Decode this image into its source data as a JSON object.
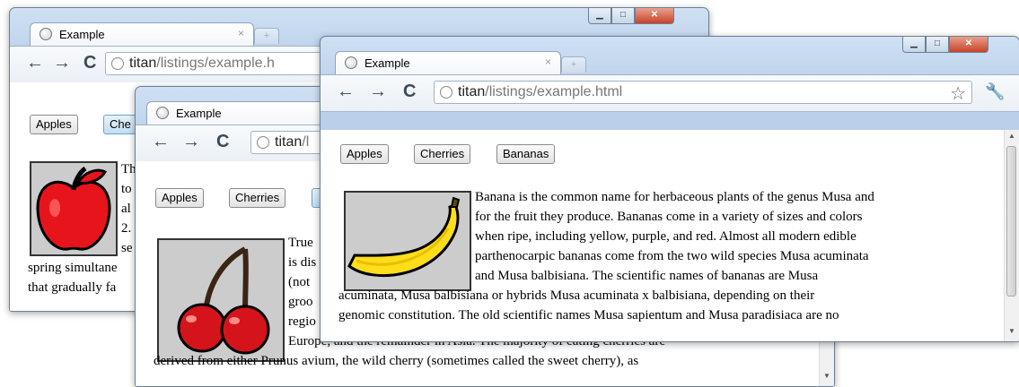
{
  "windows": {
    "apples": {
      "tab_title": "Example",
      "url_host": "titan",
      "url_path": "/listings/example.h",
      "buttons": [
        "Apples",
        "Che"
      ],
      "text_lines": [
        "Th",
        "to",
        "al",
        "2.",
        "se",
        "spring simultane",
        "that gradually fa"
      ]
    },
    "cherries": {
      "tab_title": "Example",
      "url_host": "titan",
      "url_path": "/l",
      "buttons": [
        "Apples",
        "Cherries",
        ""
      ],
      "text_lines": [
        "True",
        "is dis",
        "(not",
        "groo",
        "regio",
        "Europe, and the remainder in Asia. The majority of eating cherries are",
        "derived from either Prunus avium, the wild cherry (sometimes called the sweet cherry), as"
      ]
    },
    "bananas": {
      "tab_title": "Example",
      "url_host": "titan",
      "url_path": "/listings/example.html",
      "buttons": [
        "Apples",
        "Cherries",
        "Bananas"
      ],
      "text_lines": [
        "Banana is the common name for herbaceous plants of the genus Musa and",
        "for the fruit they produce. Bananas come in a variety of sizes and colors",
        "when ripe, including yellow, purple, and red. Almost all modern edible",
        "parthenocarpic bananas come from the two wild species Musa acuminata",
        "and Musa balbisiana. The scientific names of bananas are Musa",
        "acuminata, Musa balbisiana or hybrids Musa acuminata x balbisiana, depending on their",
        "genomic constitution. The old scientific names Musa sapientum and Musa paradisiaca are no"
      ]
    }
  },
  "controls": {
    "minimize": "▁",
    "maximize": "□",
    "close": "✕",
    "tab_close": "×",
    "new_tab": "+"
  },
  "icons": [
    "back-arrow-icon",
    "forward-arrow-icon",
    "reload-icon",
    "globe-icon",
    "star-icon",
    "wrench-icon"
  ],
  "colors": {
    "frame": "#bcd2ea",
    "close_button": "#c8432a",
    "selected_button": "#c2ddf2"
  }
}
